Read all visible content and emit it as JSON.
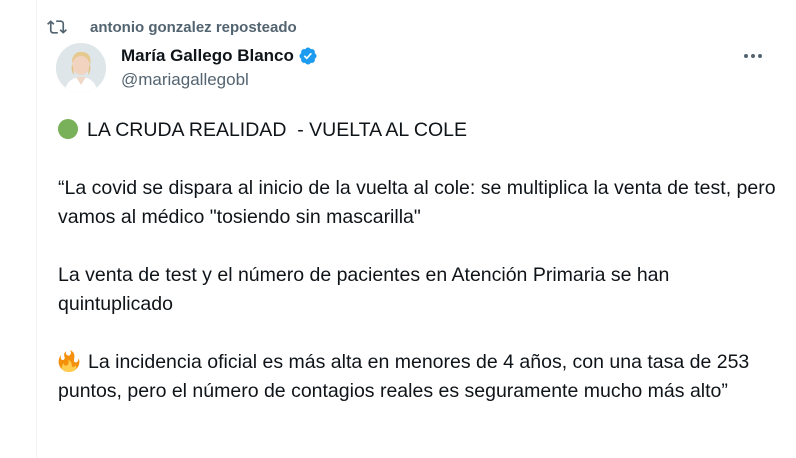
{
  "repost": {
    "icon": "repost-icon",
    "text": "antonio gonzalez reposteado"
  },
  "author": {
    "display_name": "María Gallego Blanco",
    "handle": "@mariagallegobl",
    "verified": true,
    "verified_color": "#1d9bf0"
  },
  "more_icon": "more-horizontal-icon",
  "tweet": {
    "line1": "LA CRUDA REALIDAD  - VUELTA AL COLE",
    "line1_emoji": "green-circle-icon",
    "para2": "“La covid se dispara al inicio de la vuelta al cole: se multiplica la venta de test, pero vamos al médico \"tosiendo sin mascarilla\"",
    "para3": "La venta de test y el número de pacientes en Atención Primaria se han quintuplicado",
    "para4": "La incidencia oficial es más alta en menores de 4 años, con una tasa de 253 puntos, pero el número de contagios reales es seguramente mucho más alto”",
    "para4_emoji": "fire-icon"
  },
  "colors": {
    "text_primary": "#0f1419",
    "text_secondary": "#536471",
    "border": "#eff3f4"
  }
}
